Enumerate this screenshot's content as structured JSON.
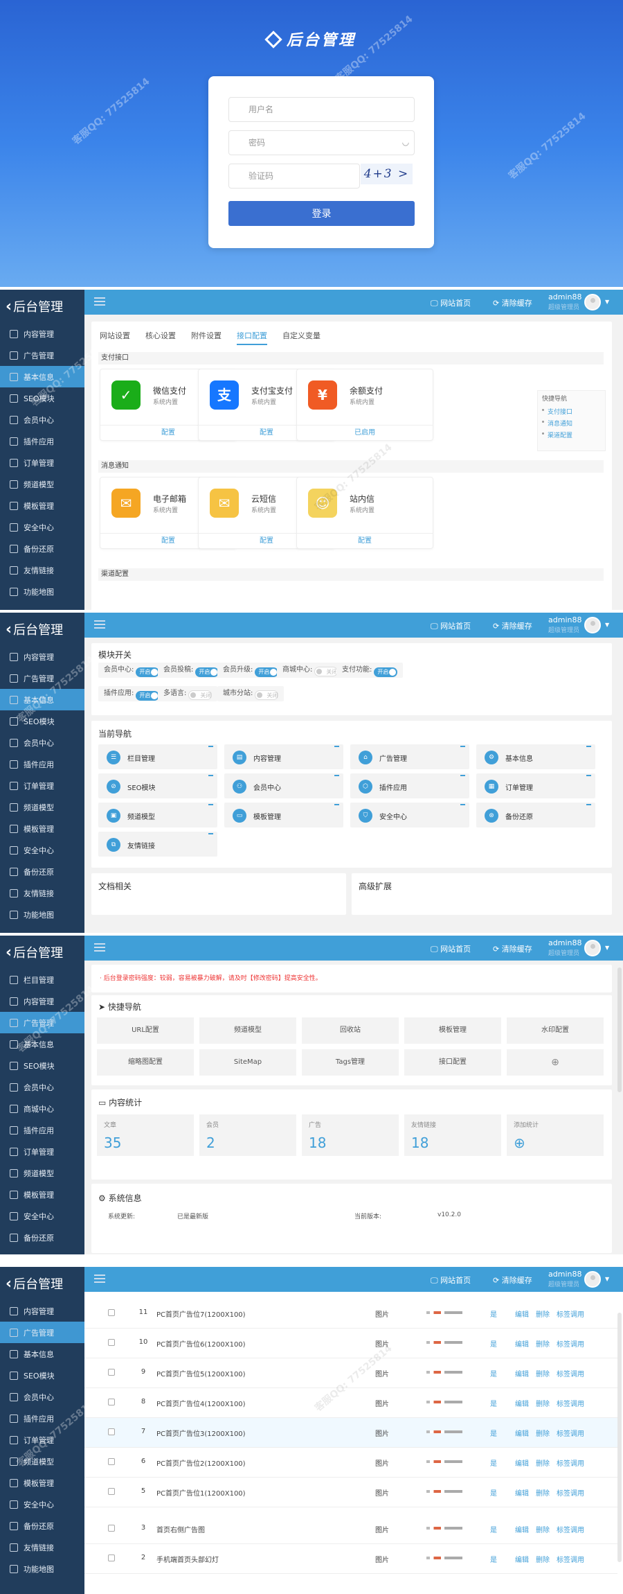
{
  "watermark": "客服QQ: 77525814",
  "login": {
    "brand": "后台管理",
    "username_placeholder": "用户名",
    "password_placeholder": "密码",
    "captcha_placeholder": "验证码",
    "captcha_text": "4+3 >",
    "submit": "登录"
  },
  "shared": {
    "logo": "后台管理",
    "site_home": "网站首页",
    "clear_cache": "清除缓存",
    "user": "admin88",
    "role": "超级管理员"
  },
  "sec2": {
    "menu": [
      "内容管理",
      "广告管理",
      "基本信息",
      "SEO模块",
      "会员中心",
      "插件应用",
      "订单管理",
      "频道模型",
      "模板管理",
      "安全中心",
      "备份还原",
      "友情链接",
      "功能地图"
    ],
    "tabs": [
      "网站设置",
      "核心设置",
      "附件设置",
      "接口配置",
      "自定义变量"
    ],
    "group_pay": "支付接口",
    "group_msg": "消息通知",
    "group_channel": "渠道配置",
    "cards": [
      {
        "name": "微信支付",
        "desc": "系统内置",
        "action": "配置",
        "color": "#1aad19",
        "icon": "✓"
      },
      {
        "name": "支付宝支付",
        "desc": "系统内置",
        "action": "配置",
        "color": "#1677ff",
        "icon": "支"
      },
      {
        "name": "余额支付",
        "desc": "系统内置",
        "action": "已启用",
        "color": "#f05b24",
        "icon": "¥"
      },
      {
        "name": "电子邮箱",
        "desc": "系统内置",
        "action": "配置",
        "color": "#f5a623",
        "icon": "✉"
      },
      {
        "name": "云短信",
        "desc": "系统内置",
        "action": "配置",
        "color": "#f6c343",
        "icon": "✉"
      },
      {
        "name": "站内信",
        "desc": "系统内置",
        "action": "配置",
        "color": "#f4d35e",
        "icon": "☺"
      }
    ],
    "quick": {
      "title": "快捷导航",
      "links": [
        "支付接口",
        "消息通知",
        "渠道配置"
      ]
    }
  },
  "sec3": {
    "menu": [
      "内容管理",
      "广告管理",
      "基本信息",
      "SEO模块",
      "会员中心",
      "插件应用",
      "订单管理",
      "频道模型",
      "模板管理",
      "安全中心",
      "备份还原",
      "友情链接",
      "功能地图"
    ],
    "module_title": "模块开关",
    "switches": [
      {
        "label": "会员中心:",
        "state": "开启",
        "on": true
      },
      {
        "label": "会员投稿:",
        "state": "开启",
        "on": true
      },
      {
        "label": "会员升级:",
        "state": "开启",
        "on": true
      },
      {
        "label": "商城中心:",
        "state": "关闭",
        "on": false
      },
      {
        "label": "支付功能:",
        "state": "开启",
        "on": true
      },
      {
        "label": "插件应用:",
        "state": "开启",
        "on": true
      },
      {
        "label": "多语言:",
        "state": "关闭",
        "on": false
      },
      {
        "label": "城市分站:",
        "state": "关闭",
        "on": false
      }
    ],
    "nav_title": "当前导航",
    "navs": [
      "栏目管理",
      "内容管理",
      "广告管理",
      "基本信息",
      "SEO模块",
      "会员中心",
      "插件应用",
      "订单管理",
      "频道模型",
      "模板管理",
      "安全中心",
      "备份还原",
      "友情链接"
    ],
    "doc_title": "文档相关",
    "ext_title": "高级扩展"
  },
  "sec4": {
    "menu": [
      "栏目管理",
      "内容管理",
      "广告管理",
      "基本信息",
      "SEO模块",
      "会员中心",
      "商城中心",
      "插件应用",
      "订单管理",
      "频道模型",
      "模板管理",
      "安全中心",
      "备份还原"
    ],
    "notice": "· 后台登录密码强度：较弱，容易被暴力破解，请及时【修改密码】提高安全性。",
    "quick_title": "快捷导航",
    "quick": [
      "URL配置",
      "频道模型",
      "回收站",
      "模板管理",
      "水印配置",
      "缩略图配置",
      "SiteMap",
      "Tags管理",
      "接口配置",
      "⊕"
    ],
    "stats_title": "内容统计",
    "stats": [
      {
        "label": "文章",
        "value": "35"
      },
      {
        "label": "会员",
        "value": "2"
      },
      {
        "label": "广告",
        "value": "18"
      },
      {
        "label": "友情链接",
        "value": "18"
      },
      {
        "label": "添加统计",
        "value": "⊕"
      }
    ],
    "sys_title": "系统信息",
    "sys": {
      "k1": "系统更新:",
      "v1": "已是最新版",
      "k2": "当前版本:",
      "v2": "v10.2.0"
    }
  },
  "sec5": {
    "menu": [
      "内容管理",
      "广告管理",
      "基本信息",
      "SEO模块",
      "会员中心",
      "插件应用",
      "订单管理",
      "频道模型",
      "模板管理",
      "安全中心",
      "备份还原",
      "友情链接",
      "功能地图"
    ],
    "rows": [
      {
        "id": "11",
        "title": "PC首页广告位7(1200X100)",
        "type": "图片",
        "status": "是"
      },
      {
        "id": "10",
        "title": "PC首页广告位6(1200X100)",
        "type": "图片",
        "status": "是"
      },
      {
        "id": "9",
        "title": "PC首页广告位5(1200X100)",
        "type": "图片",
        "status": "是"
      },
      {
        "id": "8",
        "title": "PC首页广告位4(1200X100)",
        "type": "图片",
        "status": "是"
      },
      {
        "id": "7",
        "title": "PC首页广告位3(1200X100)",
        "type": "图片",
        "status": "是"
      },
      {
        "id": "6",
        "title": "PC首页广告位2(1200X100)",
        "type": "图片",
        "status": "是"
      },
      {
        "id": "5",
        "title": "PC首页广告位1(1200X100)",
        "type": "图片",
        "status": "是"
      },
      {
        "id": "3",
        "title": "首页右侧广告图",
        "type": "图片",
        "status": "是"
      },
      {
        "id": "2",
        "title": "手机端首页头部幻灯",
        "type": "图片",
        "status": "是"
      }
    ],
    "ops": {
      "edit": "编辑",
      "del": "删除",
      "tag": "标签调用"
    }
  }
}
